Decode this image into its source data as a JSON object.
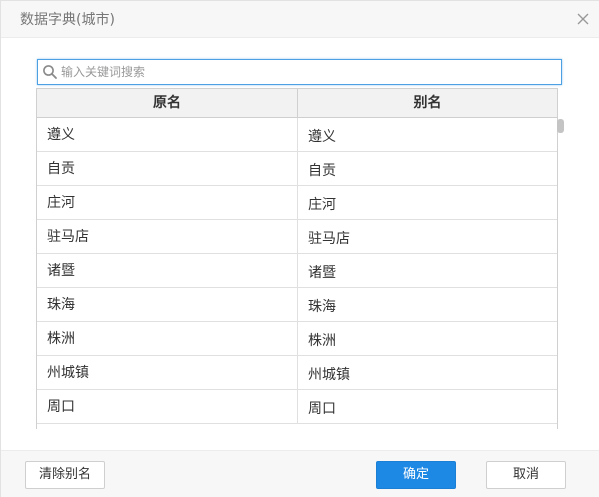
{
  "dialog": {
    "title": "数据字典(城市)"
  },
  "search": {
    "placeholder": "输入关键词搜索",
    "value": ""
  },
  "table": {
    "headers": [
      "原名",
      "别名"
    ],
    "rows": [
      [
        "遵义",
        "遵义"
      ],
      [
        "自贡",
        "自贡"
      ],
      [
        "庄河",
        "庄河"
      ],
      [
        "驻马店",
        "驻马店"
      ],
      [
        "诸暨",
        "诸暨"
      ],
      [
        "珠海",
        "珠海"
      ],
      [
        "株洲",
        "株洲"
      ],
      [
        "州城镇",
        "州城镇"
      ],
      [
        "周口",
        "周口"
      ]
    ]
  },
  "footer": {
    "clear_label": "清除别名",
    "ok_label": "确定",
    "cancel_label": "取消"
  },
  "colors": {
    "primary": "#1e88e5",
    "focus_border": "#4da0e2"
  },
  "icons": [
    "close-icon",
    "search-icon"
  ]
}
